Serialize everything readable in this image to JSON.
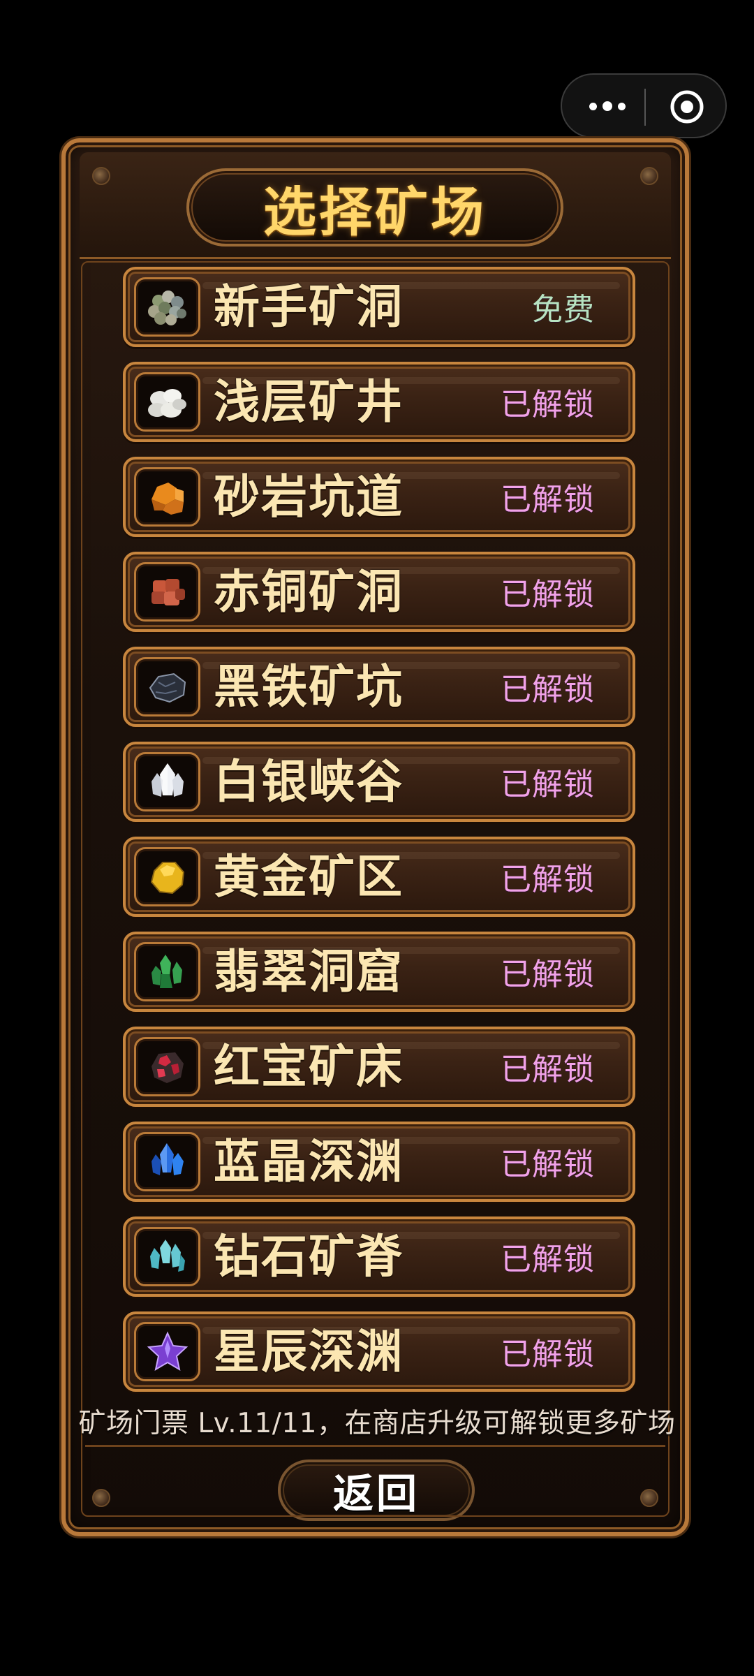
{
  "title": "选择矿场",
  "mines": [
    {
      "name": "新手矿洞",
      "status": "免费",
      "icon": "mixed-pebbles-icon"
    },
    {
      "name": "浅层矿井",
      "status": "已解锁",
      "icon": "white-stones-icon"
    },
    {
      "name": "砂岩坑道",
      "status": "已解锁",
      "icon": "orange-sandstone-icon"
    },
    {
      "name": "赤铜矿洞",
      "status": "已解锁",
      "icon": "copper-ore-icon"
    },
    {
      "name": "黑铁矿坑",
      "status": "已解锁",
      "icon": "black-iron-ore-icon"
    },
    {
      "name": "白银峡谷",
      "status": "已解锁",
      "icon": "silver-crystal-icon"
    },
    {
      "name": "黄金矿区",
      "status": "已解锁",
      "icon": "gold-nugget-icon"
    },
    {
      "name": "翡翠洞窟",
      "status": "已解锁",
      "icon": "emerald-crystal-icon"
    },
    {
      "name": "红宝矿床",
      "status": "已解锁",
      "icon": "ruby-ore-icon"
    },
    {
      "name": "蓝晶深渊",
      "status": "已解锁",
      "icon": "sapphire-crystal-icon"
    },
    {
      "name": "钻石矿脊",
      "status": "已解锁",
      "icon": "diamond-cluster-icon"
    },
    {
      "name": "星辰深渊",
      "status": "已解锁",
      "icon": "purple-star-icon"
    }
  ],
  "footer_note": "矿场门票 Lv.11/11，在商店升级可解锁更多矿场",
  "back_label": "返回",
  "colors": {
    "frame_gold": "#c8863e",
    "title_gold": "#ffd66a",
    "name_text": "#fbe6b2",
    "unlocked_status": "#f1a2e8",
    "free_status": "#b7e3c2"
  }
}
